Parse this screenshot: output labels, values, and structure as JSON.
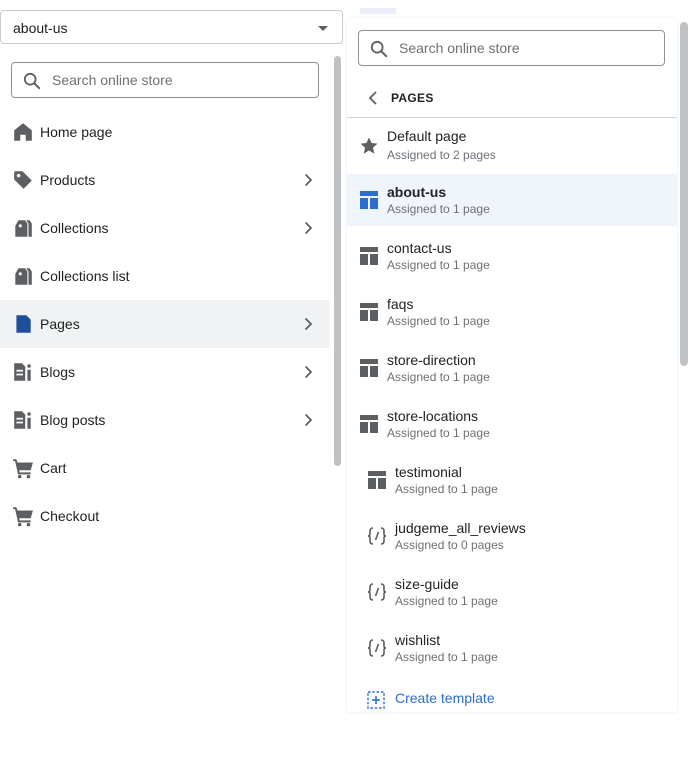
{
  "template_select": {
    "value": "about-us"
  },
  "left_search": {
    "placeholder": "Search online store"
  },
  "left_nav": {
    "items": [
      {
        "label": "Home page",
        "icon": "home-icon"
      },
      {
        "label": "Products",
        "icon": "tag-icon"
      },
      {
        "label": "Collections",
        "icon": "collections-icon"
      },
      {
        "label": "Collections list",
        "icon": "collections-icon"
      },
      {
        "label": "Pages",
        "icon": "page-icon",
        "selected": true
      },
      {
        "label": "Blogs",
        "icon": "blog-icon"
      },
      {
        "label": "Blog posts",
        "icon": "blog-icon"
      },
      {
        "label": "Cart",
        "icon": "cart-icon"
      },
      {
        "label": "Checkout",
        "icon": "cart-icon"
      }
    ]
  },
  "right_search": {
    "placeholder": "Search online store"
  },
  "pages_panel": {
    "title": "PAGES",
    "templates": [
      {
        "name": "Default page",
        "assigned": "Assigned to 2 pages",
        "icon": "star-icon"
      },
      {
        "name": "about-us",
        "assigned": "Assigned to 1 page",
        "icon": "layout-icon",
        "selected": true
      },
      {
        "name": "contact-us",
        "assigned": "Assigned to 1 page",
        "icon": "layout-icon"
      },
      {
        "name": "faqs",
        "assigned": "Assigned to 1 page",
        "icon": "layout-icon"
      },
      {
        "name": "store-direction",
        "assigned": "Assigned to 1 page",
        "icon": "layout-icon"
      },
      {
        "name": "store-locations",
        "assigned": "Assigned to 1 page",
        "icon": "layout-icon"
      },
      {
        "name": "testimonial",
        "assigned": "Assigned to 1 page",
        "icon": "layout-icon"
      },
      {
        "name": "judgeme_all_reviews",
        "assigned": "Assigned to 0 pages",
        "icon": "code-icon"
      },
      {
        "name": "size-guide",
        "assigned": "Assigned to 1 page",
        "icon": "code-icon"
      },
      {
        "name": "wishlist",
        "assigned": "Assigned to 1 page",
        "icon": "code-icon"
      }
    ],
    "create_label": "Create template"
  },
  "colors": {
    "accent": "#2c6ecb",
    "icon": "#5c5f62",
    "selected_bg": "#f0f4fb",
    "nav_selected_bg": "#f1f2f3",
    "active_icon": "#2c6ecb",
    "pages_icon": "#1f4f9c"
  }
}
